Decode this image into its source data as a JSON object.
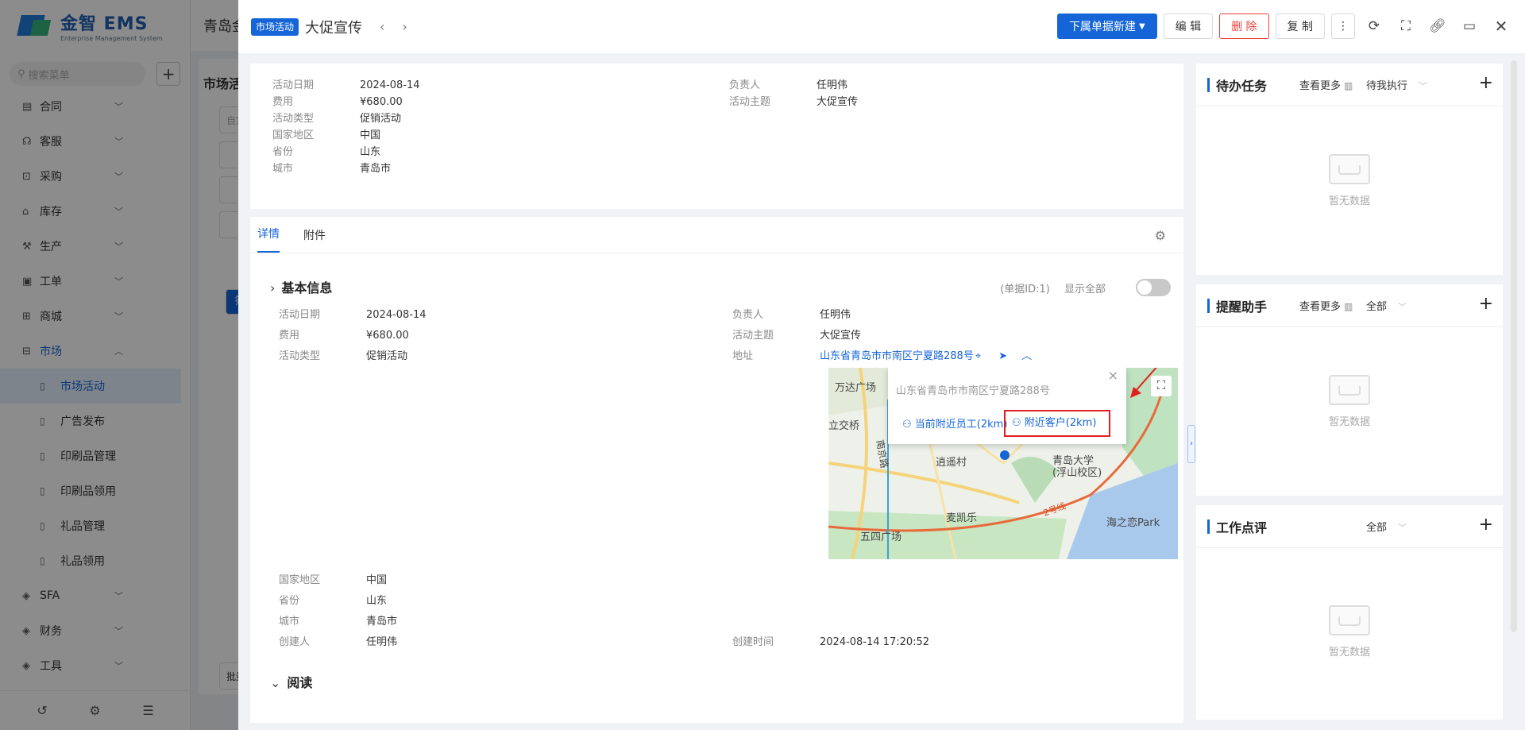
{
  "sidebar": {
    "logo_title": "金智 EMS",
    "logo_sub": "Enterprise Management System",
    "search_placeholder": "搜索菜单",
    "menu": [
      {
        "label": "合同",
        "icon": "doc"
      },
      {
        "label": "客服",
        "icon": "headset"
      },
      {
        "label": "采购",
        "icon": "cart"
      },
      {
        "label": "库存",
        "icon": "warehouse"
      },
      {
        "label": "生产",
        "icon": "factory"
      },
      {
        "label": "工单",
        "icon": "ticket"
      },
      {
        "label": "商城",
        "icon": "shop"
      },
      {
        "label": "市场",
        "icon": "market"
      }
    ],
    "submenu": [
      {
        "label": "市场活动",
        "active": true
      },
      {
        "label": "广告发布"
      },
      {
        "label": "印刷品管理"
      },
      {
        "label": "印刷品领用"
      },
      {
        "label": "礼品管理"
      },
      {
        "label": "礼品领用"
      }
    ],
    "menu_after": [
      {
        "label": "SFA"
      },
      {
        "label": "财务"
      },
      {
        "label": "工具"
      }
    ]
  },
  "bg": {
    "topbar_title": "青岛金",
    "card_title": "市场活",
    "filter_btn": "筛",
    "batch_btn": "批量",
    "field_placeholder": "自定"
  },
  "header": {
    "type_tag": "市场活动",
    "title": "大促宣传",
    "new_sub_button": "下属单据新建",
    "edit_button": "编 辑",
    "delete_button": "删 除",
    "copy_button": "复 制"
  },
  "summary": {
    "left": [
      {
        "label": "活动日期",
        "value": "2024-08-14"
      },
      {
        "label": "费用",
        "value": "¥680.00"
      },
      {
        "label": "活动类型",
        "value": "促销活动"
      },
      {
        "label": "国家地区",
        "value": "中国"
      },
      {
        "label": "省份",
        "value": "山东"
      },
      {
        "label": "城市",
        "value": "青岛市"
      }
    ],
    "right": [
      {
        "label": "负责人",
        "value": "任明伟"
      },
      {
        "label": "活动主题",
        "value": "大促宣传"
      }
    ]
  },
  "tabs": [
    "详情",
    "附件"
  ],
  "basic": {
    "title": "基本信息",
    "record_id": "(单据ID:1)",
    "show_all": "显示全部",
    "left_top": [
      {
        "label": "活动日期",
        "value": "2024-08-14"
      },
      {
        "label": "费用",
        "value": "¥680.00"
      },
      {
        "label": "活动类型",
        "value": "促销活动"
      }
    ],
    "right_top": [
      {
        "label": "负责人",
        "value": "任明伟"
      },
      {
        "label": "活动主题",
        "value": "大促宣传"
      },
      {
        "label": "地址",
        "value": "山东省青岛市市南区宁夏路288号"
      }
    ],
    "left_bottom": [
      {
        "label": "国家地区",
        "value": "中国"
      },
      {
        "label": "省份",
        "value": "山东"
      },
      {
        "label": "城市",
        "value": "青岛市"
      },
      {
        "label": "创建人",
        "value": "任明伟"
      }
    ],
    "right_bottom": [
      {
        "label": "创建时间",
        "value": "2024-08-14 17:20:52"
      }
    ]
  },
  "map": {
    "popup_address": "山东省青岛市市南区宁夏路288号",
    "nearby_staff": "当前附近员工(2km)",
    "nearby_customers": "附近客户(2km)",
    "labels": [
      "万达广场",
      "立交桥",
      "南京路",
      "逍遥村",
      "青岛大学",
      "(浮山校区)",
      "麦凯乐",
      "五四广场",
      "海之恋Park",
      "2号线"
    ]
  },
  "read_section": "阅读",
  "panels": [
    {
      "title": "待办任务",
      "more": "查看更多",
      "filter": "待我执行",
      "empty": "暂无数据"
    },
    {
      "title": "提醒助手",
      "more": "查看更多",
      "filter": "全部",
      "empty": "暂无数据"
    },
    {
      "title": "工作点评",
      "more": "",
      "filter": "全部",
      "empty": "暂无数据"
    }
  ]
}
